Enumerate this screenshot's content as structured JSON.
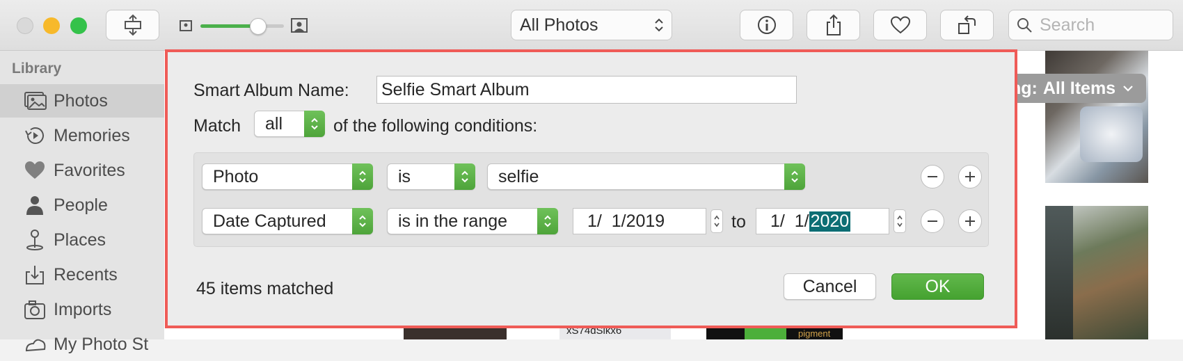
{
  "toolbar": {
    "album_popup": "All Photos",
    "search_placeholder": "Search",
    "zoom_level": 0.68
  },
  "sidebar": {
    "heading": "Library",
    "items": [
      {
        "label": "Photos",
        "icon": "photos-icon",
        "selected": true
      },
      {
        "label": "Memories",
        "icon": "memories-icon"
      },
      {
        "label": "Favorites",
        "icon": "heart-icon"
      },
      {
        "label": "People",
        "icon": "person-icon"
      },
      {
        "label": "Places",
        "icon": "pin-icon"
      },
      {
        "label": "Recents",
        "icon": "recents-icon"
      },
      {
        "label": "Imports",
        "icon": "imports-icon"
      },
      {
        "label": "My Photo St",
        "icon": "stream-icon"
      }
    ]
  },
  "main": {
    "showing_prefix": "ng:",
    "showing_value": "All Items",
    "thumb_text_1": "xS74dSlkx6",
    "thumb_text_2": "pigment"
  },
  "dialog": {
    "name_label": "Smart Album Name:",
    "name_value": "Selfie Smart Album",
    "match_label": "Match",
    "match_value": "all",
    "conditions_suffix": "of the following conditions:",
    "rule1": {
      "field": "Photo",
      "operator": "is",
      "value": "selfie"
    },
    "rule2": {
      "field": "Date Captured",
      "operator": "is in the range",
      "from": "1/  1/2019",
      "to_label": "to",
      "to_prefix": "1/  1/",
      "to_year": "2020"
    },
    "matched_text": "45 items matched",
    "cancel_label": "Cancel",
    "ok_label": "OK"
  },
  "colors": {
    "accent_green": "#4ea43a",
    "highlight": "#ef5b57",
    "selection": "#0d6e74"
  }
}
